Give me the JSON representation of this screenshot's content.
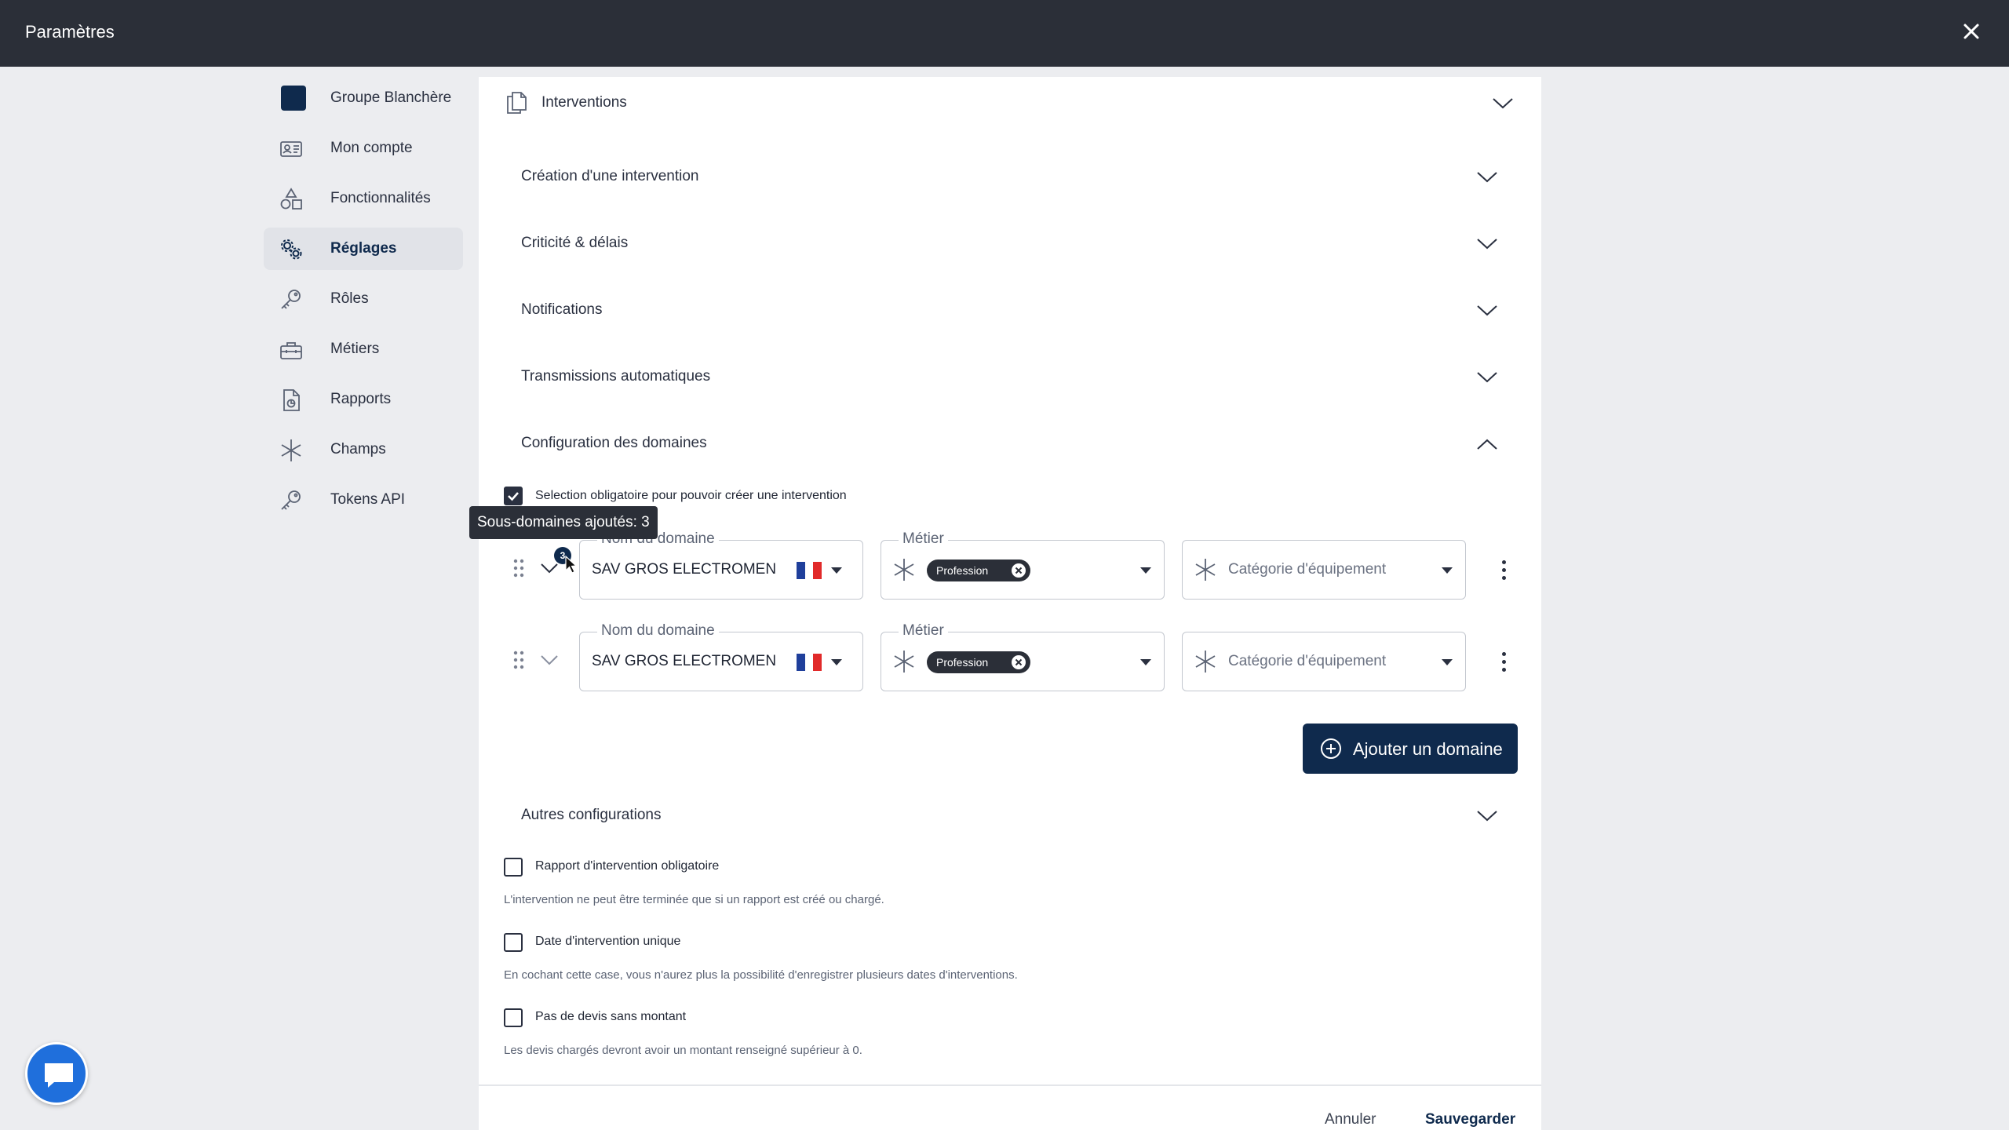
{
  "header": {
    "title": "Paramètres"
  },
  "sidebar": {
    "items": [
      {
        "label": "Groupe Blanchère",
        "icon": "organization-logo"
      },
      {
        "label": "Mon compte",
        "icon": "id-card-icon"
      },
      {
        "label": "Fonctionnalités",
        "icon": "shapes-icon"
      },
      {
        "label": "Réglages",
        "icon": "gears-icon",
        "active": true
      },
      {
        "label": "Rôles",
        "icon": "key-icon"
      },
      {
        "label": "Métiers",
        "icon": "toolbox-icon"
      },
      {
        "label": "Rapports",
        "icon": "report-icon"
      },
      {
        "label": "Champs",
        "icon": "asterisk-icon"
      },
      {
        "label": "Tokens API",
        "icon": "key-icon"
      }
    ]
  },
  "panel": {
    "title": "Interventions",
    "sections": {
      "creation": "Création d'une intervention",
      "criticite": "Criticité & délais",
      "notifications": "Notifications",
      "transmissions": "Transmissions automatiques",
      "domaines": "Configuration des domaines",
      "autres": "Autres configurations"
    },
    "domaines": {
      "mandatory_label": "Selection obligatoire pour pouvoir créer une intervention",
      "mandatory_checked": true,
      "tooltip": "Sous-domaines ajoutés: 3",
      "badge_count": "3",
      "rows": [
        {
          "domain_label": "Nom du domaine",
          "domain_value": "SAV GROS ELECTROMEN",
          "metier_label": "Métier",
          "metier_chip": "Profession",
          "categorie_placeholder": "Catégorie d'équipement"
        },
        {
          "domain_label": "Nom du domaine",
          "domain_value": "SAV GROS ELECTROMEN",
          "metier_label": "Métier",
          "metier_chip": "Profession",
          "categorie_placeholder": "Catégorie d'équipement"
        }
      ],
      "add_button": "Ajouter un domaine"
    },
    "autres": {
      "options": [
        {
          "label": "Rapport d'intervention obligatoire",
          "help": "L'intervention ne peut être terminée que si un rapport est créé ou chargé.",
          "checked": false
        },
        {
          "label": "Date d'intervention unique",
          "help": "En cochant cette case, vous n'aurez plus la possibilité d'enregistrer plusieurs dates d'interventions.",
          "checked": false
        },
        {
          "label": "Pas de devis sans montant",
          "help": "Les devis chargés devront avoir un montant renseigné supérieur à 0.",
          "checked": false
        }
      ]
    },
    "footer": {
      "cancel": "Annuler",
      "save": "Sauvegarder"
    }
  },
  "colors": {
    "primary": "#0f2a4d",
    "header": "#2b2f38",
    "chat": "#1f6fdc",
    "flag_blue": "#1f3f9b",
    "flag_red": "#e12a2a"
  }
}
